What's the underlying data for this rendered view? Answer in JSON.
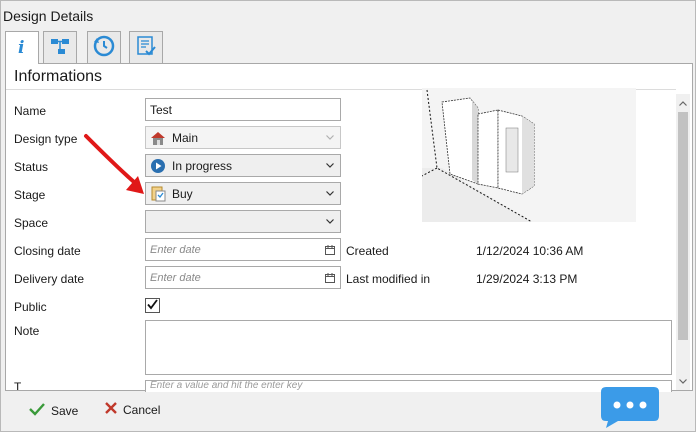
{
  "window": {
    "title": "Design Details"
  },
  "tabs": [
    {
      "icon": "info-icon"
    },
    {
      "icon": "hierarchy-icon"
    },
    {
      "icon": "history-icon"
    },
    {
      "icon": "checklist-icon"
    }
  ],
  "section": {
    "title": "Informations"
  },
  "form": {
    "name": {
      "label": "Name",
      "value": "Test"
    },
    "design_type": {
      "label": "Design type",
      "value": "Main",
      "icon": "house-icon"
    },
    "status": {
      "label": "Status",
      "value": "In progress",
      "icon": "play-circle-icon"
    },
    "stage": {
      "label": "Stage",
      "value": "Buy",
      "icon": "document-icon"
    },
    "space": {
      "label": "Space",
      "value": ""
    },
    "closing_date": {
      "label": "Closing date",
      "placeholder": "Enter date"
    },
    "delivery_date": {
      "label": "Delivery date",
      "placeholder": "Enter date"
    },
    "public": {
      "label": "Public",
      "checked": true
    },
    "note": {
      "label": "Note",
      "value": ""
    },
    "partial_label": "T",
    "partial_placeholder": "Enter a value and hit the enter key"
  },
  "meta": {
    "created_label": "Created",
    "created_value": "1/12/2024 10:36 AM",
    "modified_label": "Last modified in",
    "modified_value": "1/29/2024 3:13 PM"
  },
  "footer": {
    "save_label": "Save",
    "cancel_label": "Cancel"
  },
  "colors": {
    "accent": "#2a8ad4",
    "arrow": "#e01818",
    "chat": "#3b9be8"
  }
}
